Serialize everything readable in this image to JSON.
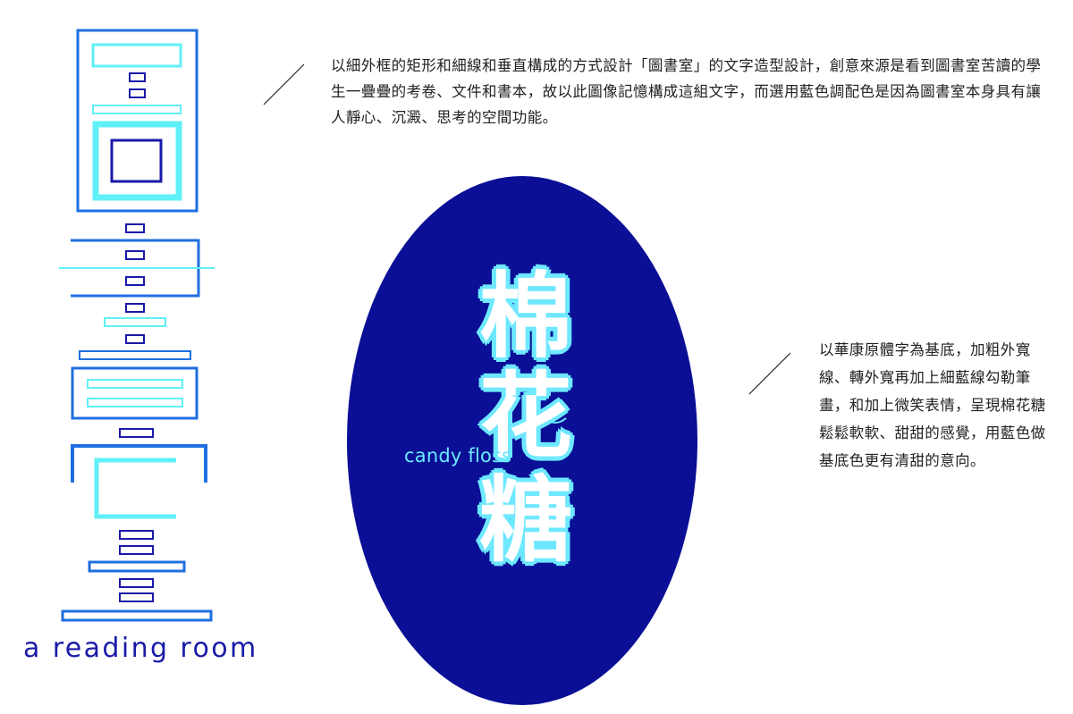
{
  "logo_art": {
    "text": "a reading room"
  },
  "candy": {
    "english_label": "candy floss",
    "characters": [
      "棉",
      "花",
      "糖"
    ]
  },
  "descriptions": {
    "reading_room": "以細外框的矩形和細線和垂直構成的方式設計「圖書室」的文字造型設計，創意來源是看到圖書室苦讀的學生一疊疊的考卷、文件和書本，故以此圖像記憶構成這組文字，而選用藍色調配色是因為圖書室本身具有讓人靜心、沉澱、思考的空間功能。",
    "candy_floss": "以華康原體字為基底，加粗外寬線、轉外寬再加上細藍線勾勒筆畫，和加上微笑表情，呈現棉花糖鬆鬆軟軟、甜甜的感覺，用藍色做基底色更有清甜的意向。"
  },
  "colors": {
    "blue": "#1f6fe0",
    "cyan": "#5ff0f8",
    "navy": "#1a1aa8",
    "ellipse": "#0a0f96",
    "candy_outline": "#6ee8ff"
  }
}
